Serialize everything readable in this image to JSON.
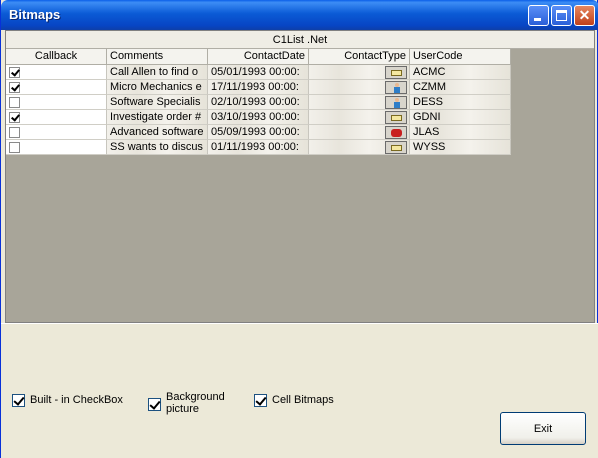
{
  "window": {
    "title": "Bitmaps"
  },
  "grid": {
    "caption": "C1List .Net",
    "headers": [
      "Callback",
      "Comments",
      "ContactDate",
      "ContactType",
      "UserCode"
    ],
    "rows": [
      {
        "callback": true,
        "comments": "Call Allen to find o",
        "date": "05/01/1993 00:00:",
        "type_icon": "envelope-icon",
        "usercode": "ACMC"
      },
      {
        "callback": true,
        "comments": "Micro Mechanics e",
        "date": "17/11/1993 00:00:",
        "type_icon": "person-icon",
        "usercode": "CZMM"
      },
      {
        "callback": false,
        "comments": "Software Specialis",
        "date": "02/10/1993 00:00:",
        "type_icon": "person-icon",
        "usercode": "DESS"
      },
      {
        "callback": true,
        "comments": "Investigate order #",
        "date": "03/10/1993 00:00:",
        "type_icon": "envelope-icon",
        "usercode": "GDNI"
      },
      {
        "callback": false,
        "comments": "Advanced software",
        "date": "05/09/1993 00:00:",
        "type_icon": "telephone-icon",
        "usercode": "JLAS"
      },
      {
        "callback": false,
        "comments": "SS wants to discus",
        "date": "01/11/1993 00:00:",
        "type_icon": "envelope-icon",
        "usercode": "WYSS"
      }
    ]
  },
  "options": {
    "builtin_checkbox": {
      "label": "Built - in  CheckBox",
      "checked": true
    },
    "background_picture": {
      "label": "Background picture",
      "checked": true
    },
    "cell_bitmaps": {
      "label": "Cell Bitmaps",
      "checked": true
    }
  },
  "buttons": {
    "exit": "Exit"
  }
}
